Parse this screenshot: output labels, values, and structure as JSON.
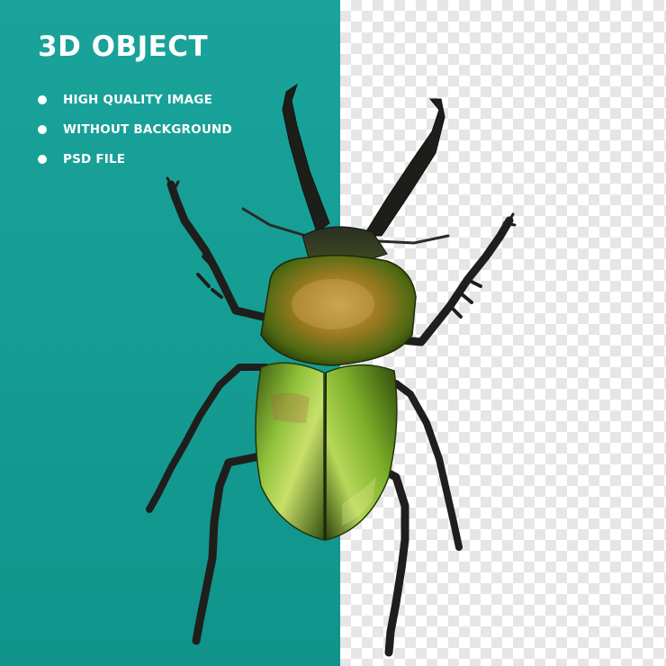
{
  "title": "3D OBJECT",
  "features": [
    "HIGH QUALITY IMAGE",
    "WITHOUT BACKGROUND",
    "PSD FILE"
  ],
  "colors": {
    "teal_panel": "#169e95",
    "checker_light": "#ffffff",
    "checker_dark": "#e6e6e6",
    "text": "#ffffff",
    "beetle_shell_green": "#6fae1e",
    "beetle_pronotum_bronze": "#b08a2a",
    "beetle_legs": "#1f1f1f"
  },
  "subject": {
    "icon": "stag-beetle-icon"
  }
}
